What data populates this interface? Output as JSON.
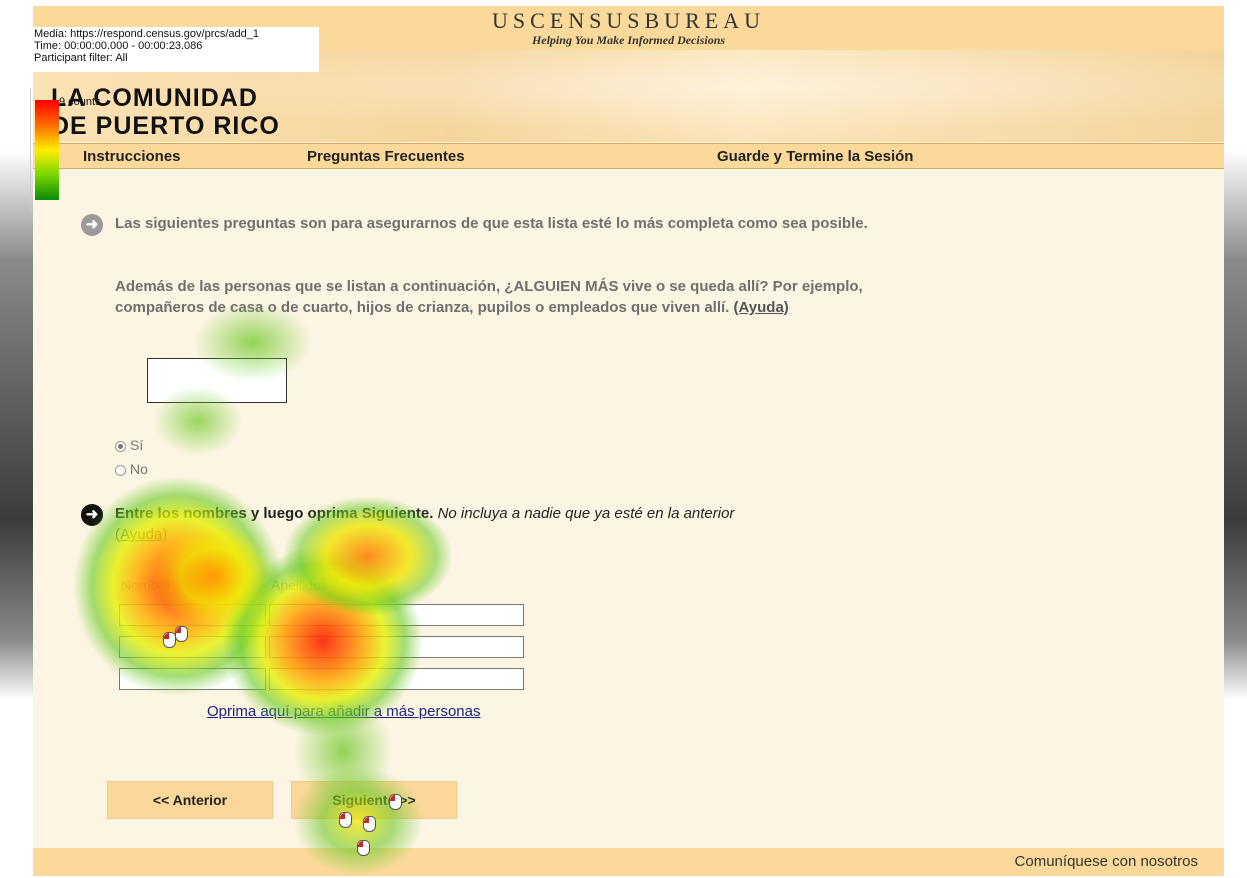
{
  "media_info": {
    "line1": "Media: https://respond.census.gov/prcs/add_1",
    "line2": "Time: 00:00:00.000 - 00:00:23.086",
    "line3": "Participant filter: All"
  },
  "legend": {
    "label": "9 counts"
  },
  "header": {
    "bureau": "USCENSUSBUREAU",
    "tagline": "Helping You Make Informed Decisions",
    "brand_line1": "LA COMUNIDAD",
    "brand_line2": "DE PUERTO RICO"
  },
  "nav": {
    "instrucciones": "Instrucciones",
    "preguntas": "Preguntas Frecuentes",
    "guarde": "Guarde y Termine la Sesión"
  },
  "question1": {
    "text": "Las siguientes preguntas son para asegurarnos de que esta lista esté lo más completa como sea posible.",
    "text2": "Además de las personas que se listan a continuación, ¿ALGUIEN MÁS vive o se queda allí? Por ejemplo, compañeros de casa o de cuarto, hijos de crianza, pupilos o empleados que viven allí.",
    "help_link": "(Ayuda)",
    "option_yes": "Sí",
    "option_no": "No",
    "selected": "Sí"
  },
  "question2": {
    "text_bold": "Entre los nombres y luego oprima Siguiente.",
    "text_italic": " No incluya a nadie que ya esté en la anterior",
    "help_link": "(Ayuda)",
    "col_first": "Nombre",
    "col_last": "Apellidos"
  },
  "add_link": "Oprima aquí para añadir a más personas",
  "buttons": {
    "previous": "<<  Anterior",
    "next": "Siguiente  >>"
  },
  "footer": {
    "contact": "Comuníquese con nosotros"
  },
  "colors": {
    "header": "#fbd99a",
    "content": "#fdf5e4",
    "link": "#1a237e"
  }
}
